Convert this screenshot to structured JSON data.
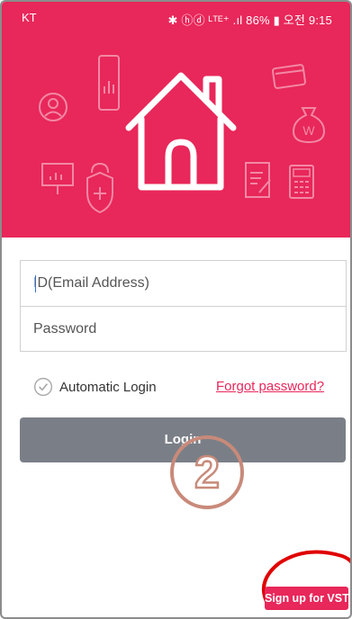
{
  "status_bar": {
    "carrier": "KT",
    "indicators": "✱ ⓗⓓ ᴸᵀᴱ⁺ .ıl 86% ▮ 오전 9:15"
  },
  "icons": {
    "hero": "house-icon",
    "decor": [
      "user-icon",
      "phone-chart-icon",
      "card-icon",
      "money-bag-icon",
      "presentation-icon",
      "lock-shield-icon",
      "clipboard-icon",
      "calculator-icon"
    ]
  },
  "login_form": {
    "id_placeholder": "ID(Email Address)",
    "password_placeholder": "Password"
  },
  "automatic_login_label": "Automatic Login",
  "forgot_password_link": "Forgot password?",
  "login_button_label": "Login",
  "annotation_number": "2",
  "signup_button_label": "Sign up for VST",
  "colors": {
    "brand": "#e8275a",
    "login_button": "#7a7f87",
    "annotation": "#c88a7a",
    "highlight": "#e00000"
  }
}
